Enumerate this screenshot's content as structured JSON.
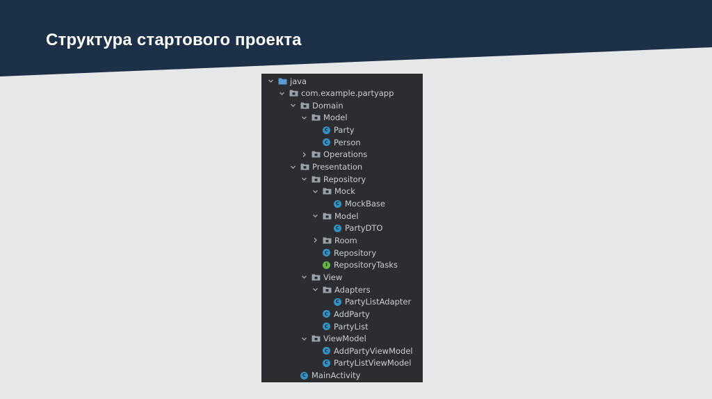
{
  "slide": {
    "title": "Структура стартового проекта",
    "colors": {
      "header_band": "#1c3048",
      "background": "#e6e7e9",
      "panel": "#2b2d30"
    }
  },
  "tree": [
    {
      "label": "java",
      "kind": "folder",
      "depth": 0,
      "expanded": true
    },
    {
      "label": "com.example.partyapp",
      "kind": "package",
      "depth": 1,
      "expanded": true
    },
    {
      "label": "Domain",
      "kind": "package",
      "depth": 2,
      "expanded": true
    },
    {
      "label": "Model",
      "kind": "package",
      "depth": 3,
      "expanded": true
    },
    {
      "label": "Party",
      "kind": "class",
      "depth": 4
    },
    {
      "label": "Person",
      "kind": "class",
      "depth": 4
    },
    {
      "label": "Operations",
      "kind": "package",
      "depth": 3
    },
    {
      "label": "Presentation",
      "kind": "package",
      "depth": 2,
      "expanded": true
    },
    {
      "label": "Repository",
      "kind": "package",
      "depth": 3,
      "expanded": true
    },
    {
      "label": "Mock",
      "kind": "package",
      "depth": 4,
      "expanded": true
    },
    {
      "label": "MockBase",
      "kind": "class",
      "depth": 5
    },
    {
      "label": "Model",
      "kind": "package",
      "depth": 4,
      "expanded": true
    },
    {
      "label": "PartyDTO",
      "kind": "class",
      "depth": 5
    },
    {
      "label": "Room",
      "kind": "package",
      "depth": 4,
      "expanded": false
    },
    {
      "label": "Repository",
      "kind": "class",
      "depth": 4
    },
    {
      "label": "RepositoryTasks",
      "kind": "interface",
      "depth": 4
    },
    {
      "label": "View",
      "kind": "package",
      "depth": 3,
      "expanded": true
    },
    {
      "label": "Adapters",
      "kind": "package",
      "depth": 4,
      "expanded": true
    },
    {
      "label": "PartyListAdapter",
      "kind": "class",
      "depth": 5
    },
    {
      "label": "AddParty",
      "kind": "class",
      "depth": 4
    },
    {
      "label": "PartyList",
      "kind": "class",
      "depth": 4
    },
    {
      "label": "ViewModel",
      "kind": "package",
      "depth": 3,
      "expanded": true
    },
    {
      "label": "AddPartyViewModel",
      "kind": "class",
      "depth": 4
    },
    {
      "label": "PartyListViewModel",
      "kind": "class",
      "depth": 4
    },
    {
      "label": "MainActivity",
      "kind": "class",
      "depth": 2
    }
  ]
}
